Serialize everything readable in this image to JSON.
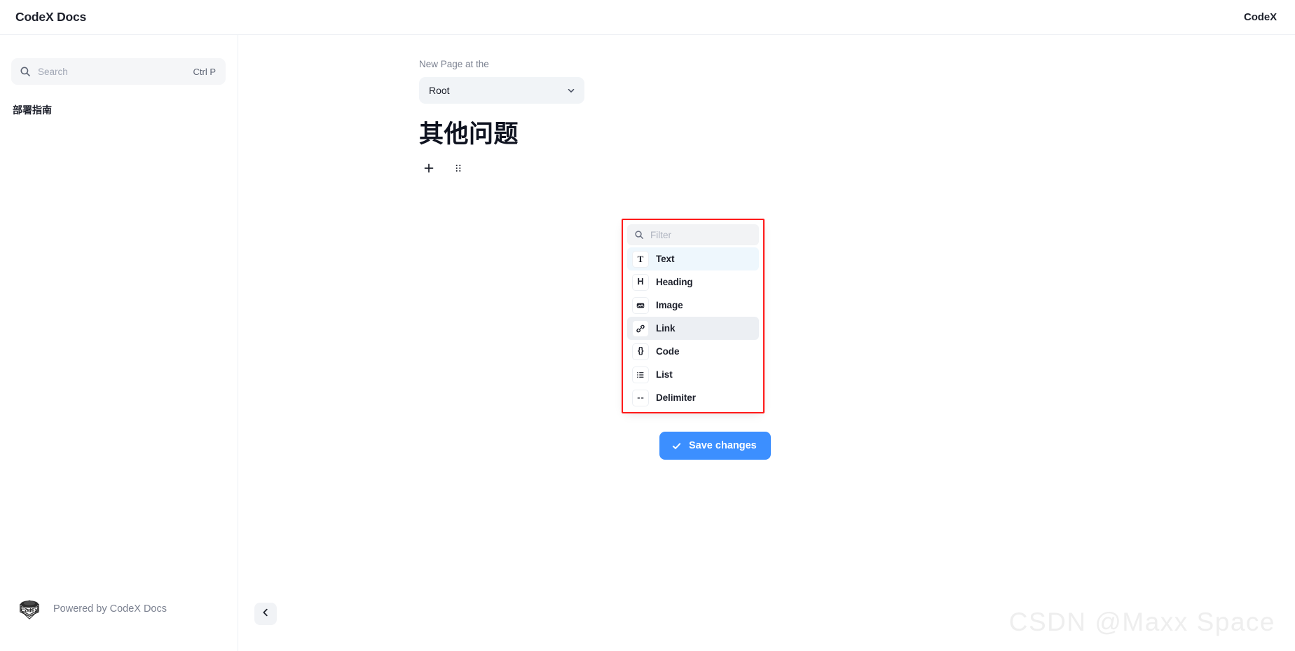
{
  "header": {
    "brand": "CodeX Docs",
    "right_label": "CodeX"
  },
  "sidebar": {
    "search": {
      "placeholder": "Search",
      "shortcut": "Ctrl P",
      "icon": "search-icon"
    },
    "nav_items": [
      {
        "label": "部署指南"
      }
    ],
    "footer": {
      "text": "Powered by CodeX Docs",
      "logo_alt": "CodeX"
    },
    "collapse_icon": "chevron-left-icon"
  },
  "editor": {
    "field_label": "New Page at the",
    "parent_select": {
      "value": "Root",
      "chevron": "chevron-down-icon",
      "options": [
        "Root"
      ]
    },
    "page_title": "其他问题",
    "block_tunes": {
      "add_icon": "plus-icon",
      "drag_icon": "drag-handle-icon"
    },
    "save_button": {
      "label": "Save changes",
      "icon": "check-icon",
      "color": "#3c8fff"
    }
  },
  "toolbox": {
    "filter": {
      "placeholder": "Filter",
      "icon": "search-icon"
    },
    "highlight_color": "#ff1a1a",
    "items": [
      {
        "label": "Text",
        "icon": "text-icon",
        "glyph": "T",
        "state": "active"
      },
      {
        "label": "Heading",
        "icon": "heading-icon",
        "glyph": "H",
        "state": "normal"
      },
      {
        "label": "Image",
        "icon": "image-icon",
        "glyph": "",
        "state": "normal"
      },
      {
        "label": "Link",
        "icon": "link-icon",
        "glyph": "",
        "state": "hovered"
      },
      {
        "label": "Code",
        "icon": "code-icon",
        "glyph": "{}",
        "state": "normal"
      },
      {
        "label": "List",
        "icon": "list-icon",
        "glyph": "",
        "state": "normal"
      },
      {
        "label": "Delimiter",
        "icon": "delimiter-icon",
        "glyph": "--",
        "state": "normal"
      }
    ]
  },
  "watermark": {
    "text": "CSDN @Maxx Space"
  }
}
